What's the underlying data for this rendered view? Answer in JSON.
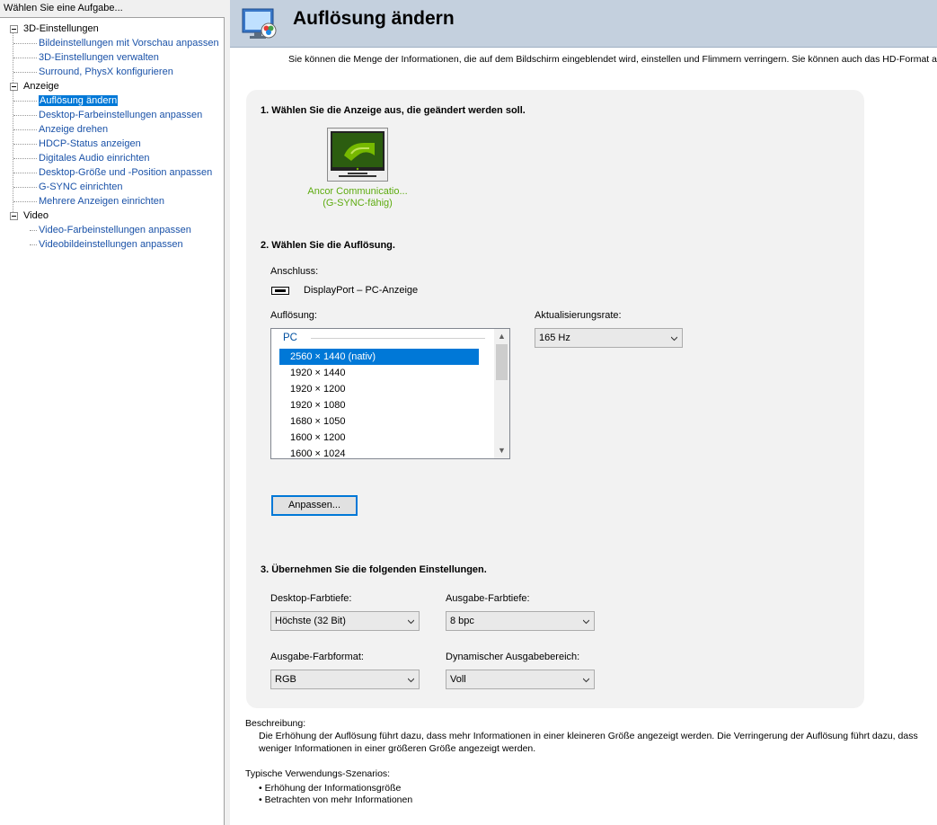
{
  "left_panel": {
    "header": "Wählen Sie eine Aufgabe...",
    "groups": [
      {
        "label": "3D-Einstellungen",
        "items": [
          "Bildeinstellungen mit Vorschau anpassen",
          "3D-Einstellungen verwalten",
          "Surround, PhysX konfigurieren"
        ]
      },
      {
        "label": "Anzeige",
        "items": [
          "Auflösung ändern",
          "Desktop-Farbeinstellungen anpassen",
          "Anzeige drehen",
          "HDCP-Status anzeigen",
          "Digitales Audio einrichten",
          "Desktop-Größe und -Position anpassen",
          "G-SYNC einrichten",
          "Mehrere Anzeigen einrichten"
        ]
      },
      {
        "label": "Video",
        "items": [
          "Video-Farbeinstellungen anpassen",
          "Videobildeinstellungen anpassen"
        ]
      }
    ],
    "selected_item": "Auflösung ändern"
  },
  "header": {
    "title": "Auflösung ändern",
    "intro": "Sie können die Menge der Informationen, die auf dem Bildschirm eingeblendet wird, einstellen und Flimmern verringern. Sie können auch das HD-Format au"
  },
  "section1": {
    "title": "1. Wählen Sie die Anzeige aus, die geändert werden soll.",
    "monitor_name": "Ancor Communicatio...",
    "monitor_sub": "(G-SYNC-fähig)"
  },
  "section2": {
    "title": "2. Wählen Sie die Auflösung.",
    "connection_label": "Anschluss:",
    "connection_value": "DisplayPort – PC-Anzeige",
    "resolution_label": "Auflösung:",
    "resolution_group": "PC",
    "resolutions": [
      "2560 × 1440 (nativ)",
      "1920 × 1440",
      "1920 × 1200",
      "1920 × 1080",
      "1680 × 1050",
      "1600 × 1200",
      "1600 × 1024"
    ],
    "selected_resolution": "2560 × 1440 (nativ)",
    "refresh_label": "Aktualisierungsrate:",
    "refresh_value": "165 Hz",
    "customize_button": "Anpassen..."
  },
  "section3": {
    "title": "3. Übernehmen Sie die folgenden Einstellungen.",
    "desktop_depth_label": "Desktop-Farbtiefe:",
    "desktop_depth_value": "Höchste (32 Bit)",
    "output_depth_label": "Ausgabe-Farbtiefe:",
    "output_depth_value": "8 bpc",
    "output_format_label": "Ausgabe-Farbformat:",
    "output_format_value": "RGB",
    "dynamic_range_label": "Dynamischer Ausgabebereich:",
    "dynamic_range_value": "Voll"
  },
  "description": {
    "heading": "Beschreibung:",
    "text": "Die Erhöhung der Auflösung führt dazu, dass mehr Informationen in einer kleineren Größe angezeigt werden. Die Verringerung der Auflösung führt dazu, dass weniger Informationen in einer größeren Größe angezeigt werden."
  },
  "scenarios": {
    "heading": "Typische Verwendungs-Szenarios:",
    "items": [
      "Erhöhung der Informationsgröße",
      "Betrachten von mehr Informationen"
    ]
  },
  "colors": {
    "accent": "#0078d7",
    "link": "#1a52a8",
    "nvidia_green": "#76b900",
    "header_bg": "#c4d0de"
  }
}
